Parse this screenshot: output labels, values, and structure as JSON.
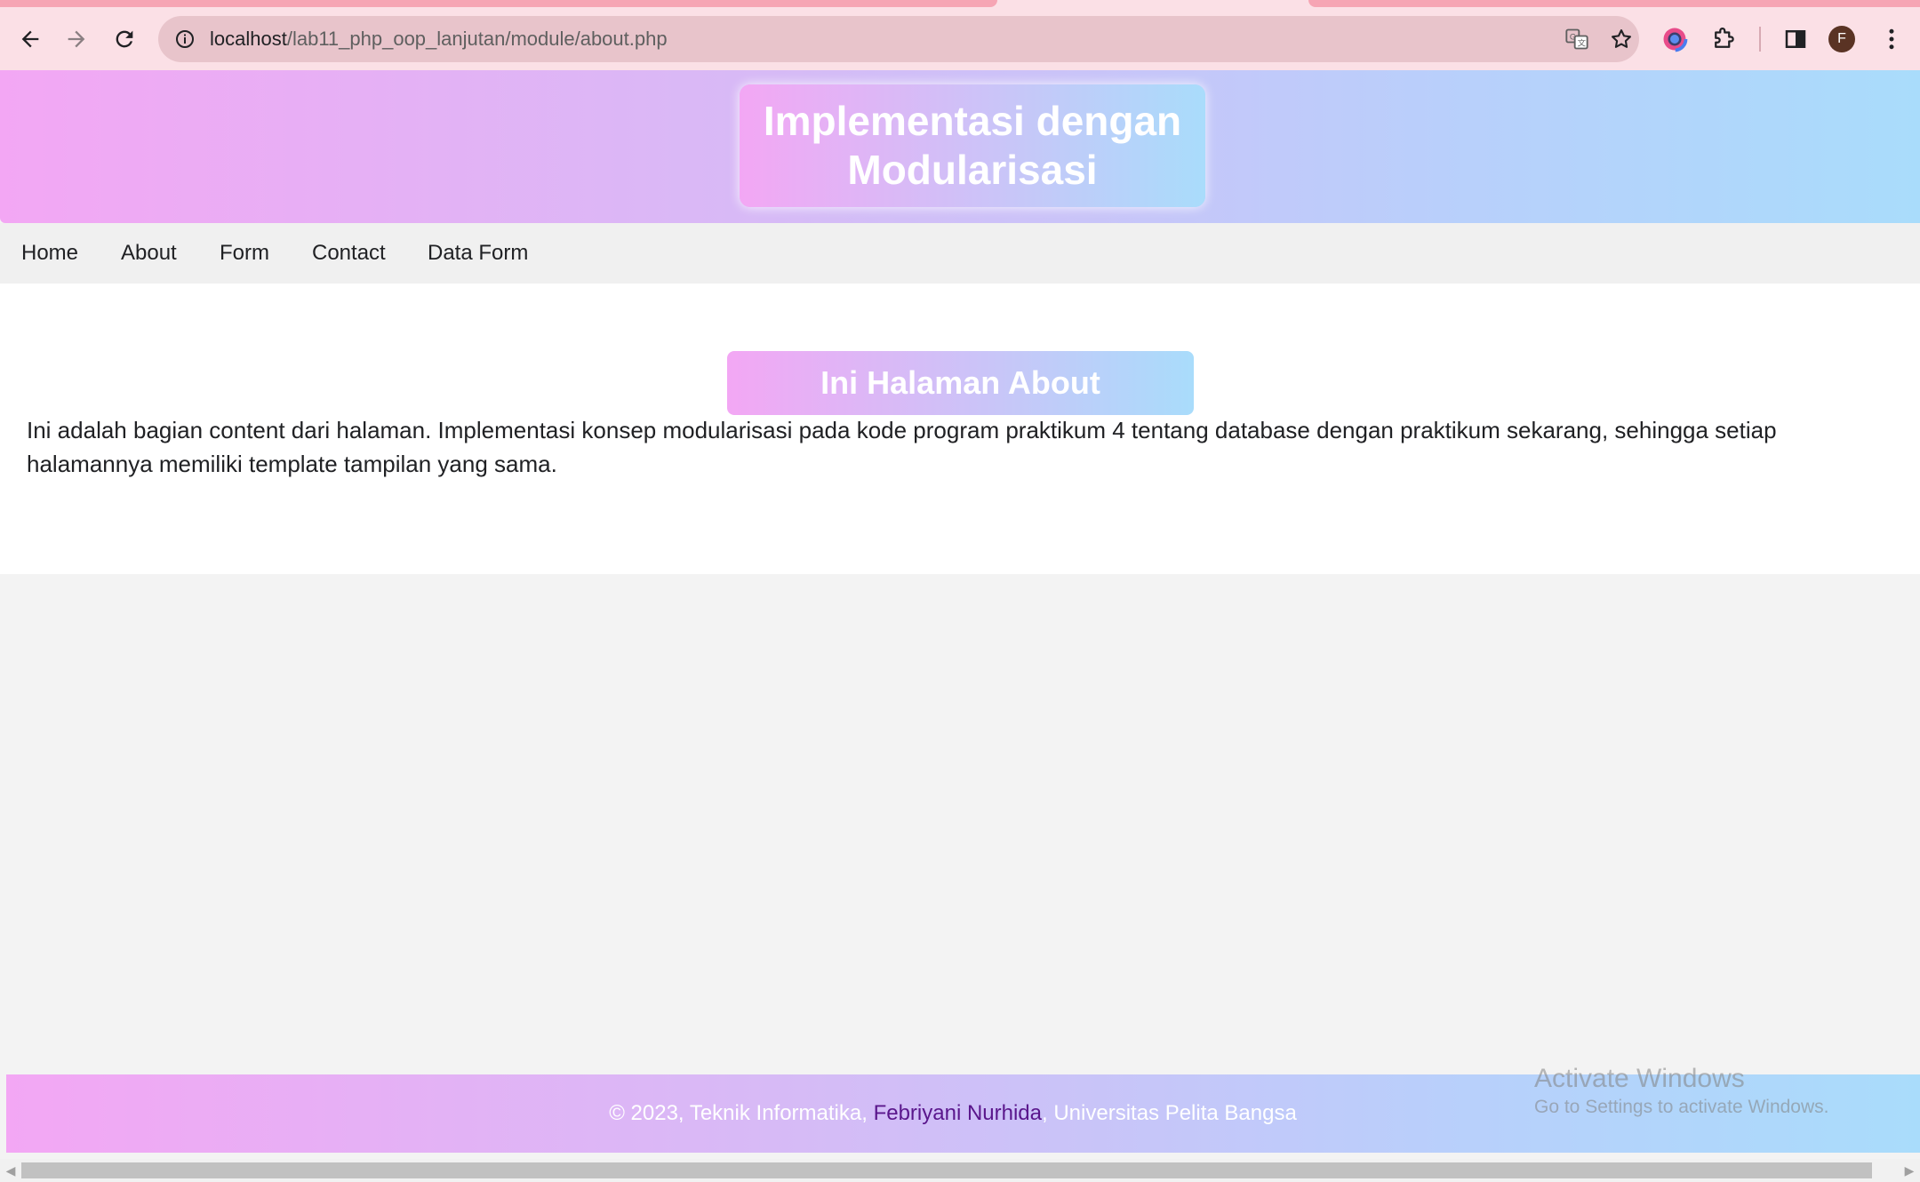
{
  "browser": {
    "url_host": "localhost",
    "url_path": "/lab11_php_oop_lanjutan/module/about.php",
    "profile_initial": "F"
  },
  "header": {
    "title": "Implementasi dengan Modularisasi"
  },
  "nav": {
    "items": [
      "Home",
      "About",
      "Form",
      "Contact",
      "Data Form"
    ]
  },
  "content": {
    "heading": "Ini Halaman About",
    "body": "Ini adalah bagian content dari halaman. Implementasi konsep modularisasi pada kode program praktikum 4 tentang database dengan praktikum sekarang, sehingga setiap halamannya memiliki template tampilan yang sama."
  },
  "footer": {
    "prefix": "© 2023, Teknik Informatika, ",
    "author": "Febriyani Nurhida",
    "suffix": ", Universitas Pelita Bangsa"
  },
  "watermark": {
    "line1": "Activate Windows",
    "line2": "Go to Settings to activate Windows."
  },
  "colors": {
    "gradient_start": "#f3a7f4",
    "gradient_end": "#a9dcfb",
    "author_link": "#5a168c"
  }
}
